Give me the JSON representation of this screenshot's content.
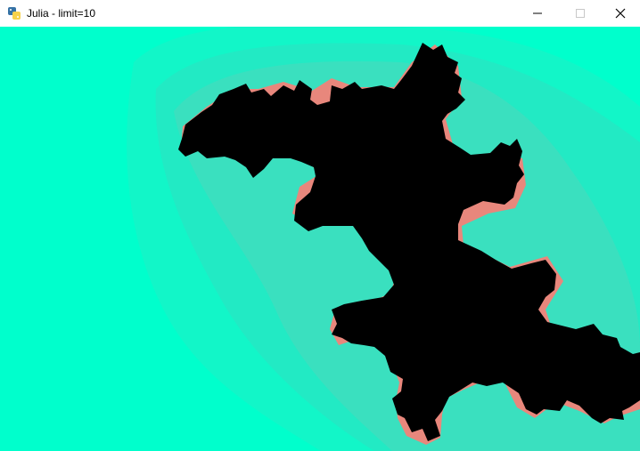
{
  "window": {
    "title": "Julia - limit=10",
    "icon": "python-icon",
    "controls": [
      "minimize-icon",
      "maximize-icon",
      "close-icon"
    ]
  },
  "fractal": {
    "type": "julia-set",
    "limit": 10,
    "colors": {
      "background": "#00ffcc",
      "outer_band": "#12f6c8",
      "mid_band": "#22eac4",
      "inner_band": "#3ae0bf",
      "edge": "#e8877c",
      "set": "#000000"
    }
  }
}
